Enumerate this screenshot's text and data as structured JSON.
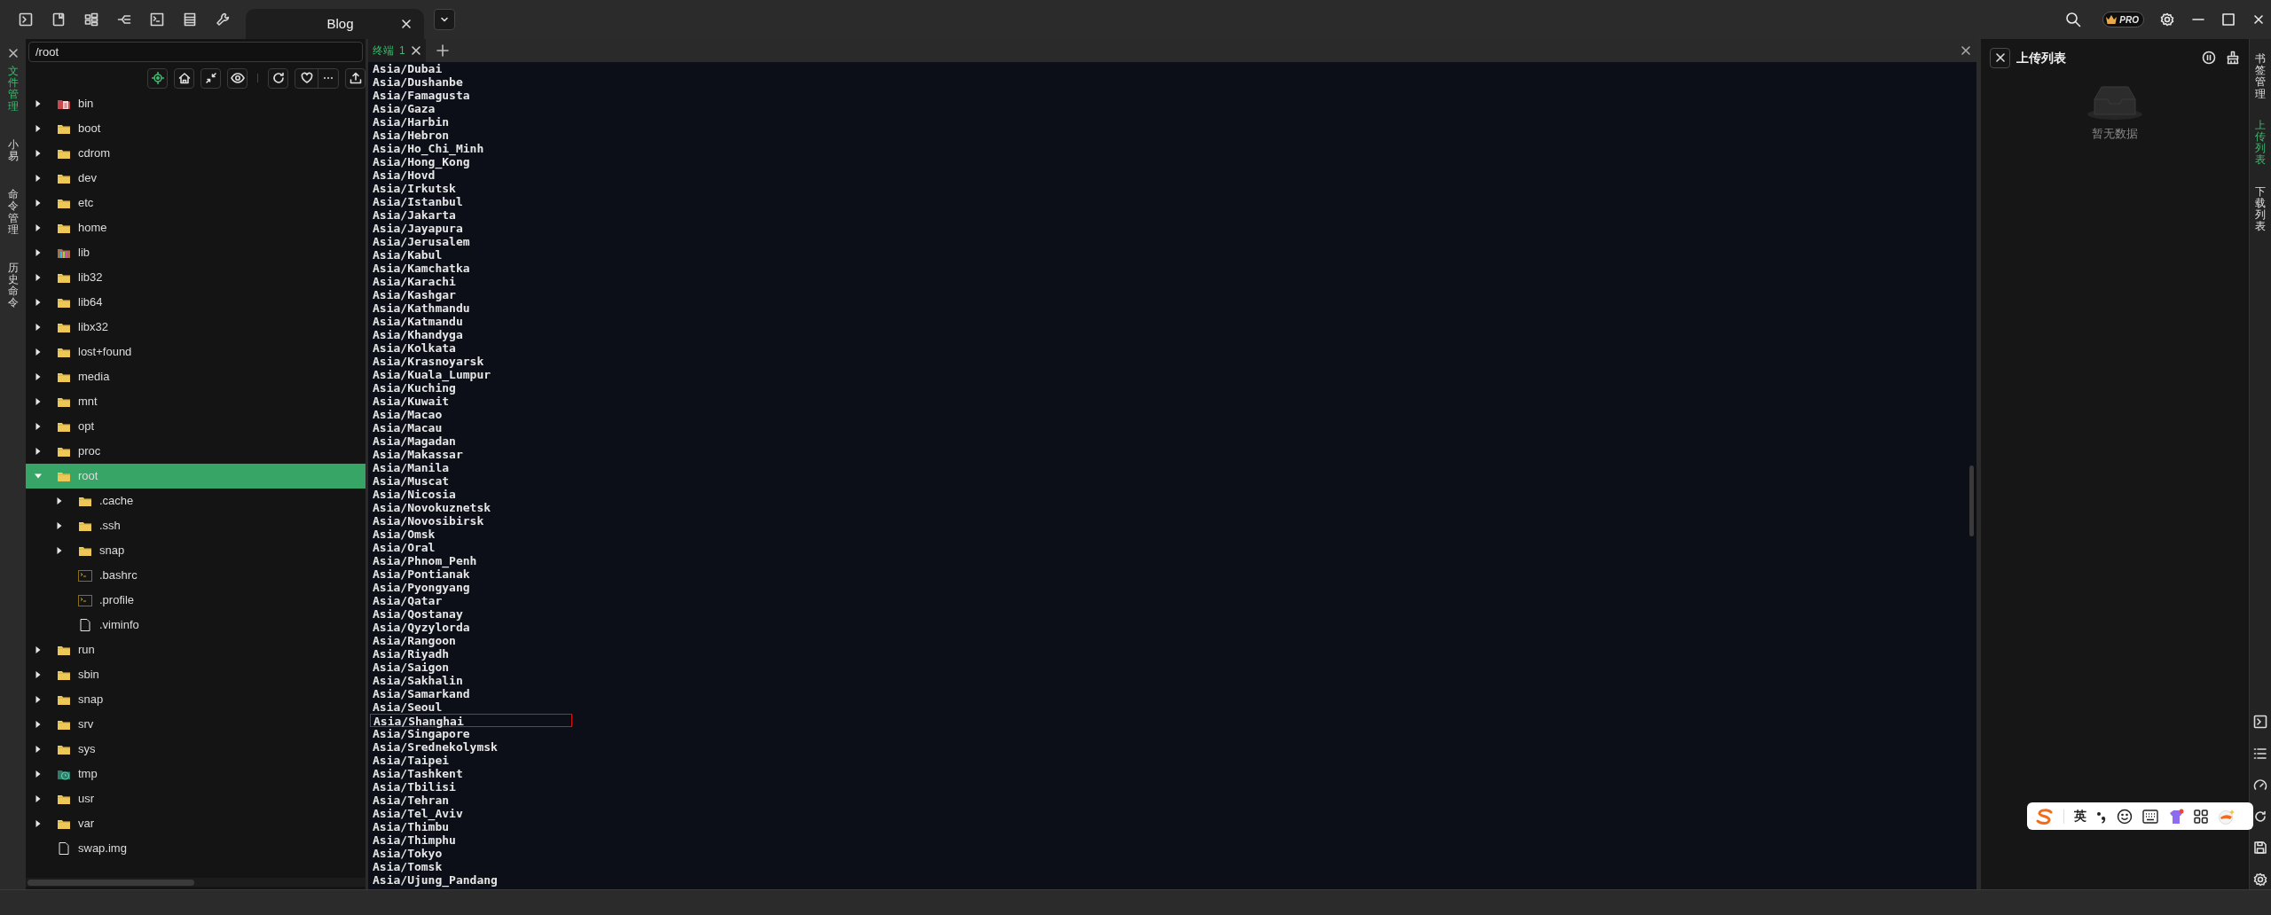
{
  "top_tabs": [
    {
      "label": "Blog",
      "selected": true
    }
  ],
  "pro_badge": "PRO",
  "left_sidebar": [
    {
      "label": "文件管理",
      "selected": true
    },
    {
      "label": "小易",
      "selected": false
    },
    {
      "label": "命令管理",
      "selected": false
    },
    {
      "label": "历史命令",
      "selected": false
    }
  ],
  "file_manager": {
    "path": "/root",
    "tree": [
      {
        "name": "bin",
        "kind": "system-folder",
        "expanded": false
      },
      {
        "name": "boot",
        "kind": "folder",
        "expanded": false
      },
      {
        "name": "cdrom",
        "kind": "folder",
        "expanded": false
      },
      {
        "name": "dev",
        "kind": "folder",
        "expanded": false
      },
      {
        "name": "etc",
        "kind": "folder",
        "expanded": false
      },
      {
        "name": "home",
        "kind": "folder",
        "expanded": false
      },
      {
        "name": "lib",
        "kind": "library-folder",
        "expanded": false
      },
      {
        "name": "lib32",
        "kind": "folder",
        "expanded": false
      },
      {
        "name": "lib64",
        "kind": "folder",
        "expanded": false
      },
      {
        "name": "libx32",
        "kind": "folder",
        "expanded": false
      },
      {
        "name": "lost+found",
        "kind": "folder",
        "expanded": false
      },
      {
        "name": "media",
        "kind": "folder",
        "expanded": false
      },
      {
        "name": "mnt",
        "kind": "folder",
        "expanded": false
      },
      {
        "name": "opt",
        "kind": "folder",
        "expanded": false
      },
      {
        "name": "proc",
        "kind": "folder",
        "expanded": false
      },
      {
        "name": "root",
        "kind": "folder",
        "expanded": true,
        "selected": true,
        "children": [
          {
            "name": ".cache",
            "kind": "folder",
            "expanded": false
          },
          {
            "name": ".ssh",
            "kind": "folder",
            "expanded": false
          },
          {
            "name": "snap",
            "kind": "folder",
            "expanded": false
          },
          {
            "name": ".bashrc",
            "kind": "script-file"
          },
          {
            "name": ".profile",
            "kind": "script-file"
          },
          {
            "name": ".viminfo",
            "kind": "file"
          }
        ]
      },
      {
        "name": "run",
        "kind": "folder",
        "expanded": false
      },
      {
        "name": "sbin",
        "kind": "folder",
        "expanded": false
      },
      {
        "name": "snap",
        "kind": "folder",
        "expanded": false
      },
      {
        "name": "srv",
        "kind": "folder",
        "expanded": false
      },
      {
        "name": "sys",
        "kind": "folder",
        "expanded": false
      },
      {
        "name": "tmp",
        "kind": "temp-folder",
        "expanded": false
      },
      {
        "name": "usr",
        "kind": "folder",
        "expanded": false
      },
      {
        "name": "var",
        "kind": "folder",
        "expanded": false
      },
      {
        "name": "swap.img",
        "kind": "file"
      }
    ]
  },
  "terminal": {
    "tabs": [
      {
        "label": "终端",
        "number": "1",
        "selected": true
      }
    ],
    "lines": [
      {
        "text": "Asia/Dubai",
        "highlighted": false
      },
      {
        "text": "Asia/Dushanbe",
        "highlighted": false
      },
      {
        "text": "Asia/Famagusta",
        "highlighted": false
      },
      {
        "text": "Asia/Gaza",
        "highlighted": false
      },
      {
        "text": "Asia/Harbin",
        "highlighted": false
      },
      {
        "text": "Asia/Hebron",
        "highlighted": false
      },
      {
        "text": "Asia/Ho_Chi_Minh",
        "highlighted": false
      },
      {
        "text": "Asia/Hong_Kong",
        "highlighted": false
      },
      {
        "text": "Asia/Hovd",
        "highlighted": false
      },
      {
        "text": "Asia/Irkutsk",
        "highlighted": false
      },
      {
        "text": "Asia/Istanbul",
        "highlighted": false
      },
      {
        "text": "Asia/Jakarta",
        "highlighted": false
      },
      {
        "text": "Asia/Jayapura",
        "highlighted": false
      },
      {
        "text": "Asia/Jerusalem",
        "highlighted": false
      },
      {
        "text": "Asia/Kabul",
        "highlighted": false
      },
      {
        "text": "Asia/Kamchatka",
        "highlighted": false
      },
      {
        "text": "Asia/Karachi",
        "highlighted": false
      },
      {
        "text": "Asia/Kashgar",
        "highlighted": false
      },
      {
        "text": "Asia/Kathmandu",
        "highlighted": false
      },
      {
        "text": "Asia/Katmandu",
        "highlighted": false
      },
      {
        "text": "Asia/Khandyga",
        "highlighted": false
      },
      {
        "text": "Asia/Kolkata",
        "highlighted": false
      },
      {
        "text": "Asia/Krasnoyarsk",
        "highlighted": false
      },
      {
        "text": "Asia/Kuala_Lumpur",
        "highlighted": false
      },
      {
        "text": "Asia/Kuching",
        "highlighted": false
      },
      {
        "text": "Asia/Kuwait",
        "highlighted": false
      },
      {
        "text": "Asia/Macao",
        "highlighted": false
      },
      {
        "text": "Asia/Macau",
        "highlighted": false
      },
      {
        "text": "Asia/Magadan",
        "highlighted": false
      },
      {
        "text": "Asia/Makassar",
        "highlighted": false
      },
      {
        "text": "Asia/Manila",
        "highlighted": false
      },
      {
        "text": "Asia/Muscat",
        "highlighted": false
      },
      {
        "text": "Asia/Nicosia",
        "highlighted": false
      },
      {
        "text": "Asia/Novokuznetsk",
        "highlighted": false
      },
      {
        "text": "Asia/Novosibirsk",
        "highlighted": false
      },
      {
        "text": "Asia/Omsk",
        "highlighted": false
      },
      {
        "text": "Asia/Oral",
        "highlighted": false
      },
      {
        "text": "Asia/Phnom_Penh",
        "highlighted": false
      },
      {
        "text": "Asia/Pontianak",
        "highlighted": false
      },
      {
        "text": "Asia/Pyongyang",
        "highlighted": false
      },
      {
        "text": "Asia/Qatar",
        "highlighted": false
      },
      {
        "text": "Asia/Qostanay",
        "highlighted": false
      },
      {
        "text": "Asia/Qyzylorda",
        "highlighted": false
      },
      {
        "text": "Asia/Rangoon",
        "highlighted": false
      },
      {
        "text": "Asia/Riyadh",
        "highlighted": false
      },
      {
        "text": "Asia/Saigon",
        "highlighted": false
      },
      {
        "text": "Asia/Sakhalin",
        "highlighted": false
      },
      {
        "text": "Asia/Samarkand",
        "highlighted": false
      },
      {
        "text": "Asia/Seoul",
        "highlighted": false
      },
      {
        "text": "Asia/Shanghai",
        "highlighted": true
      },
      {
        "text": "Asia/Singapore",
        "highlighted": false
      },
      {
        "text": "Asia/Srednekolymsk",
        "highlighted": false
      },
      {
        "text": "Asia/Taipei",
        "highlighted": false
      },
      {
        "text": "Asia/Tashkent",
        "highlighted": false
      },
      {
        "text": "Asia/Tbilisi",
        "highlighted": false
      },
      {
        "text": "Asia/Tehran",
        "highlighted": false
      },
      {
        "text": "Asia/Tel_Aviv",
        "highlighted": false
      },
      {
        "text": "Asia/Thimbu",
        "highlighted": false
      },
      {
        "text": "Asia/Thimphu",
        "highlighted": false
      },
      {
        "text": "Asia/Tokyo",
        "highlighted": false
      },
      {
        "text": "Asia/Tomsk",
        "highlighted": false
      },
      {
        "text": "Asia/Ujung_Pandang",
        "highlighted": false
      }
    ]
  },
  "upload_panel": {
    "title": "上传列表",
    "empty_text": "暂无数据"
  },
  "right_sidebar": [
    {
      "label": "书签管理",
      "selected": false
    },
    {
      "label": "上传列表",
      "selected": true
    },
    {
      "label": "下载列表",
      "selected": false
    }
  ],
  "ime_toolbar": {
    "mode": "英"
  }
}
